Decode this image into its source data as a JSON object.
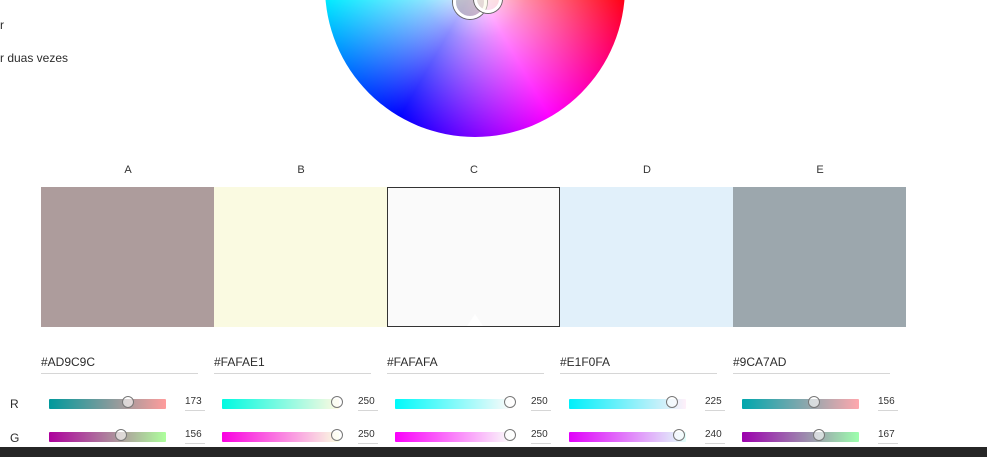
{
  "left_text": {
    "line1": "r",
    "line2": "r duas vezes"
  },
  "columns": [
    {
      "label": "A",
      "hex": "#AD9C9C",
      "color": "#AD9C9C"
    },
    {
      "label": "B",
      "hex": "#FAFAE1",
      "color": "#FAFAE1"
    },
    {
      "label": "C",
      "hex": "#FAFAFA",
      "color": "#FAFAFA"
    },
    {
      "label": "D",
      "hex": "#E1F0FA",
      "color": "#E1F0FA"
    },
    {
      "label": "E",
      "hex": "#9CA7AD",
      "color": "#9CA7AD"
    }
  ],
  "rows": {
    "r": "R",
    "g": "G"
  },
  "r_values": [
    "173",
    "250",
    "250",
    "225",
    "156"
  ],
  "g_values": [
    "156",
    "250",
    "250",
    "240",
    "167"
  ],
  "r_gradients": [
    [
      "#00999c",
      "#ff9c9c"
    ],
    [
      "#00fae1",
      "#fffae1"
    ],
    [
      "#00fafa",
      "#fffafa"
    ],
    [
      "#00f0fa",
      "#fff0fa"
    ],
    [
      "#00a7ad",
      "#ffa7ad"
    ]
  ],
  "g_gradients": [
    [
      "#ad009c",
      "#adff9c"
    ],
    [
      "#fa00e1",
      "#faffe1"
    ],
    [
      "#fa00fa",
      "#fafffa"
    ],
    [
      "#e100fa",
      "#e1fffa"
    ],
    [
      "#9c00ad",
      "#9cffad"
    ]
  ]
}
